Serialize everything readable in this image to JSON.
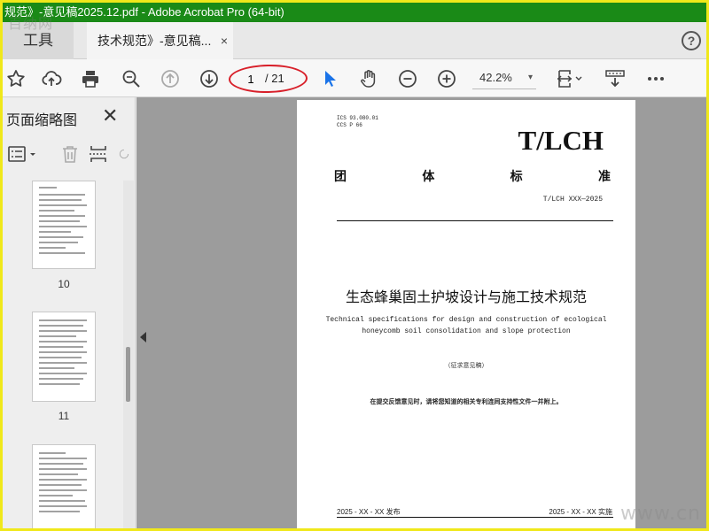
{
  "window": {
    "title": "规范》-意见稿2025.12.pdf - Adobe Acrobat Pro (64-bit)",
    "watermark_logo": "百纳网",
    "watermark_corner": "www.cn"
  },
  "tabs": {
    "tools_label": "工具",
    "doc_label": "技术规范》-意见稿...",
    "close_glyph": "×",
    "help_glyph": "?"
  },
  "toolbar": {
    "page_current": "1",
    "page_total": "/ 21",
    "zoom": "42.2%",
    "zoom_dropdown_glyph": "▾",
    "highlight_color": "#d8202a",
    "select_tool_color": "#1a73e8",
    "icons": [
      "star-icon",
      "cloud-upload-icon",
      "print-icon",
      "zoom-search-icon",
      "page-up-icon",
      "page-down-icon",
      "select-arrow-icon",
      "hand-icon",
      "zoom-out-icon",
      "zoom-in-icon",
      "fit-page-icon",
      "scroll-mode-icon",
      "more-icon"
    ]
  },
  "panel": {
    "title": "页面缩略图",
    "close_glyph": "✕",
    "thumbnails": [
      {
        "label": "10"
      },
      {
        "label": "11"
      },
      {
        "label": ""
      }
    ]
  },
  "document": {
    "ics_line1": "ICS 93.080.01",
    "ics_line2": "CCS P 66",
    "brand": "T/LCH",
    "std_chars": [
      "团",
      "体",
      "标",
      "准"
    ],
    "code": "T/LCH XXX—2025",
    "title_cn": "生态蜂巢固土护坡设计与施工技术规范",
    "title_en_line1": "Technical specifications for design and construction of ecological",
    "title_en_line2": "honeycomb soil consolidation and slope protection",
    "draft": "（征求意见稿）",
    "note": "在提交反馈意见时，请将您知道的相关专利连同支持性文件一并附上。",
    "publish": "2025 - XX - XX 发布",
    "implement": "2025 - XX - XX 实施"
  }
}
